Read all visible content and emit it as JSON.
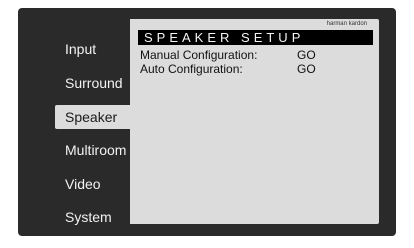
{
  "menu": {
    "items": [
      {
        "label": "Input"
      },
      {
        "label": "Surround"
      },
      {
        "label": "Speaker"
      },
      {
        "label": "Multiroom"
      },
      {
        "label": "Video"
      },
      {
        "label": "System"
      }
    ],
    "selected": "Speaker"
  },
  "panel": {
    "brand": "harman kardon",
    "title": "SPEAKER SETUP",
    "rows": [
      {
        "label": "Manual Configuration:",
        "value": "GO"
      },
      {
        "label": "Auto Configuration:",
        "value": "GO"
      }
    ]
  },
  "colors": {
    "screen_bg": "#2a2a2a",
    "panel_bg": "#dcdcdc",
    "title_bar": "#000000"
  }
}
